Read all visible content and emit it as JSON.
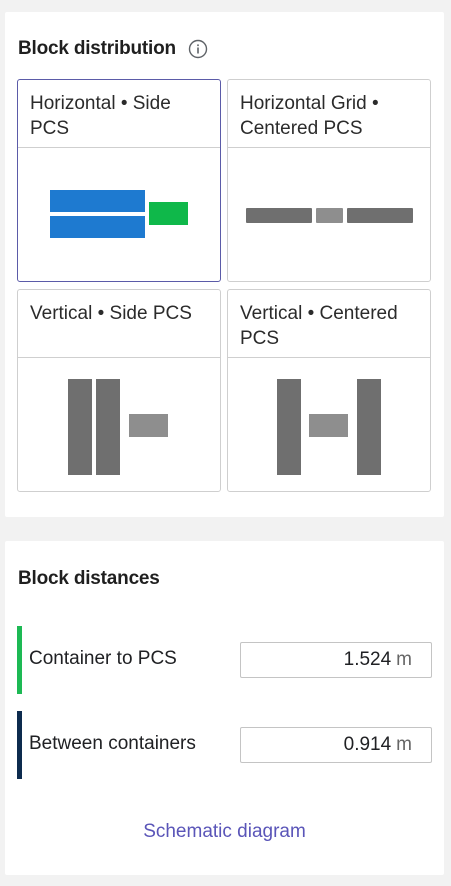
{
  "block_distribution": {
    "title": "Block distribution",
    "info_icon": "info-circle-icon",
    "options": [
      {
        "label": "Horizontal • Side PCS",
        "selected": true
      },
      {
        "label": "Horizontal Grid • Centered PCS",
        "selected": false
      },
      {
        "label": "Vertical • Side PCS",
        "selected": false
      },
      {
        "label": "Vertical • Centered PCS",
        "selected": false
      }
    ]
  },
  "block_distances": {
    "title": "Block distances",
    "rows": [
      {
        "label": "Container to PCS",
        "value": "1.524",
        "unit": "m",
        "accent_color": "#1db954"
      },
      {
        "label": "Between containers",
        "value": "0.914",
        "unit": "m",
        "accent_color": "#0d2b4e"
      }
    ],
    "link_label": "Schematic diagram"
  },
  "colors": {
    "selected_border": "#5b5ba8",
    "container_blue": "#1e7ad0",
    "pcs_green": "#0fb84a",
    "block_gray": "#6f6f6f",
    "pcs_gray": "#8e8e8e",
    "link": "#5a55b8"
  }
}
